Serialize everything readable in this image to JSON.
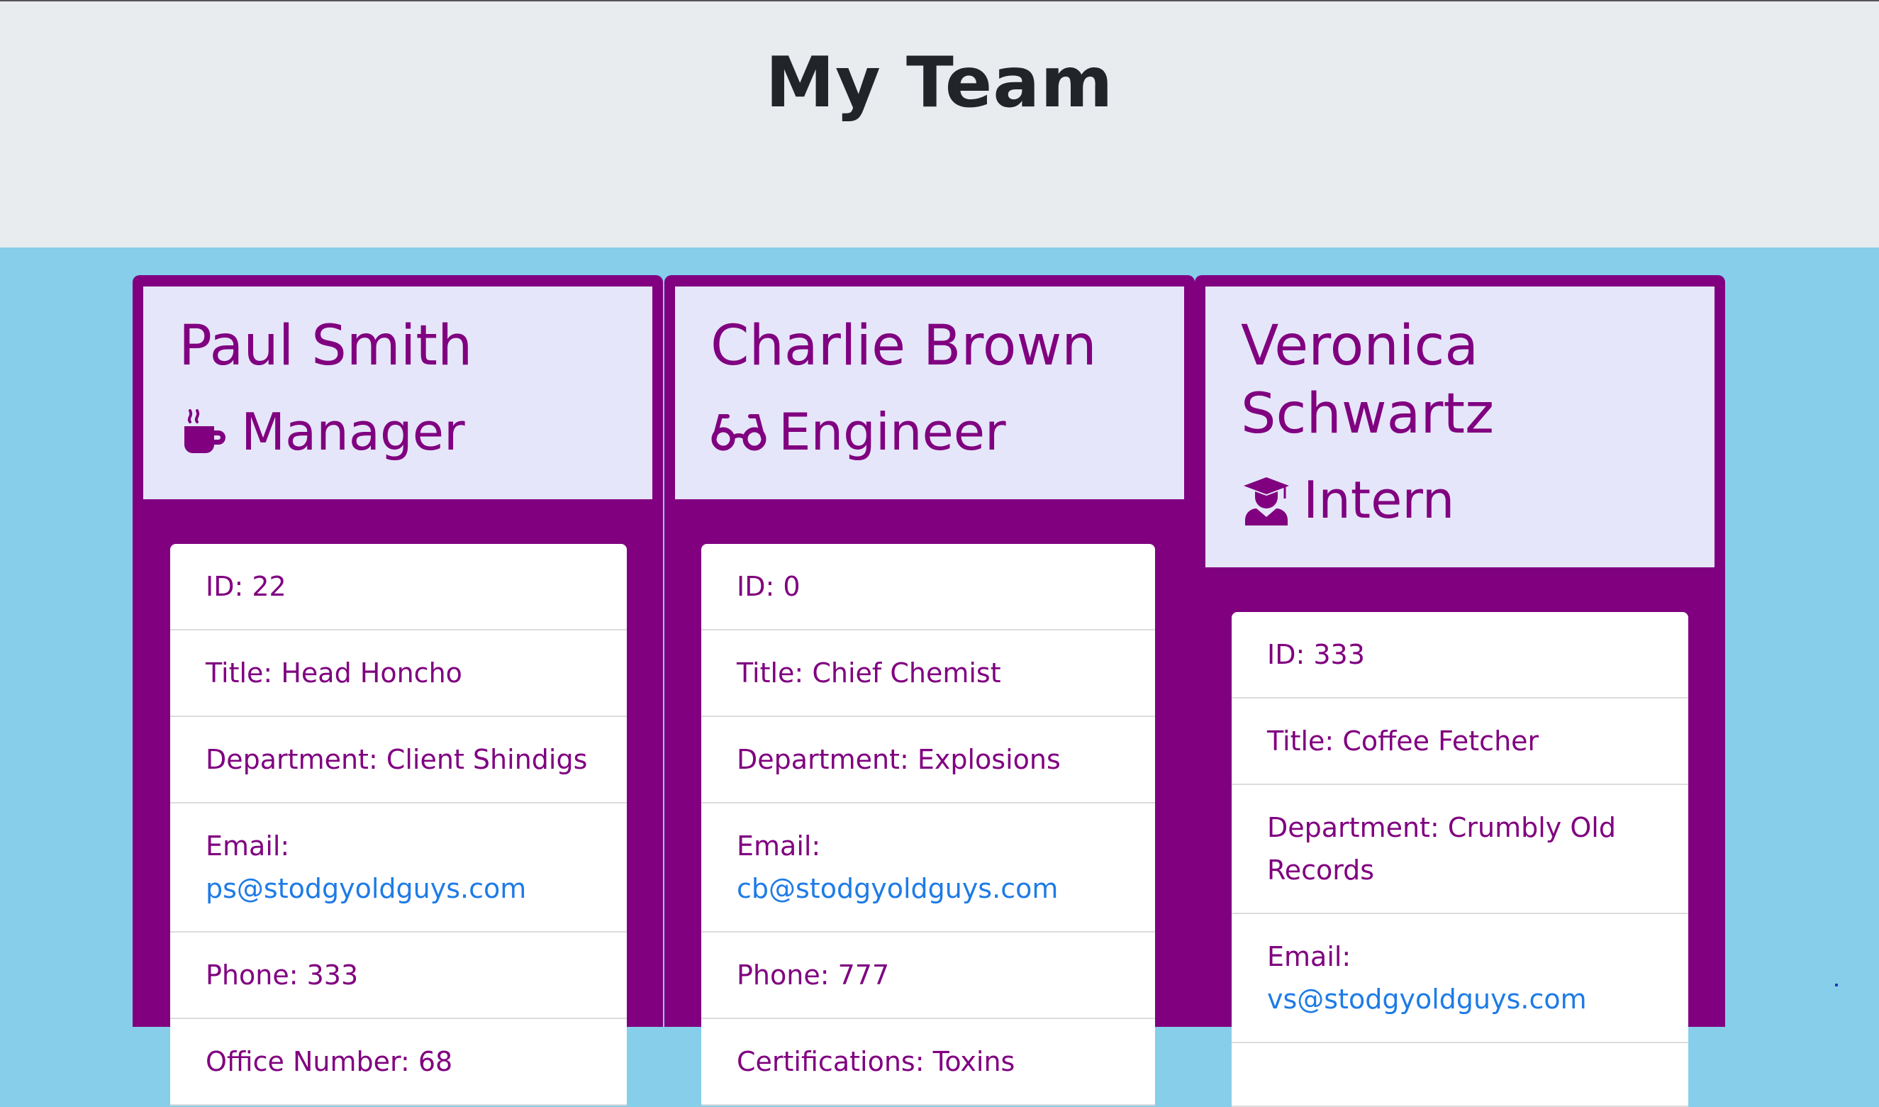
{
  "page": {
    "title": "My Team"
  },
  "team": [
    {
      "name": "Paul Smith",
      "role": "Manager",
      "role_icon": "mug-icon",
      "details": [
        {
          "label": "ID: ",
          "value": "22"
        },
        {
          "label": "Title: ",
          "value": "Head Honcho"
        },
        {
          "label": "Department: ",
          "value": "Client Shindigs"
        },
        {
          "label": "Email: ",
          "value": "ps@stodgyoldguys.com",
          "link": true
        },
        {
          "label": "Phone: ",
          "value": "333"
        },
        {
          "label": "Office Number: ",
          "value": "68"
        }
      ]
    },
    {
      "name": "Charlie Brown",
      "role": "Engineer",
      "role_icon": "glasses-icon",
      "details": [
        {
          "label": "ID: ",
          "value": "0"
        },
        {
          "label": "Title: ",
          "value": "Chief Chemist"
        },
        {
          "label": "Department: ",
          "value": "Explosions"
        },
        {
          "label": "Email: ",
          "value": "cb@stodgyoldguys.com",
          "link": true
        },
        {
          "label": "Phone: ",
          "value": "777"
        },
        {
          "label": "Certifications: ",
          "value": "Toxins"
        }
      ]
    },
    {
      "name": "Veronica Schwartz",
      "role": "Intern",
      "role_icon": "graduate-icon",
      "details": [
        {
          "label": "ID: ",
          "value": "333"
        },
        {
          "label": "Title: ",
          "value": "Coffee Fetcher"
        },
        {
          "label": "Department: ",
          "value": "Crumbly Old Records"
        },
        {
          "label": "Email: ",
          "value": "vs@stodgyoldguys.com",
          "link": true
        }
      ]
    }
  ],
  "colors": {
    "card": "#800080",
    "header": "#e6e6fa",
    "link": "#1e7be6",
    "page_bg": "#87ceeb"
  }
}
